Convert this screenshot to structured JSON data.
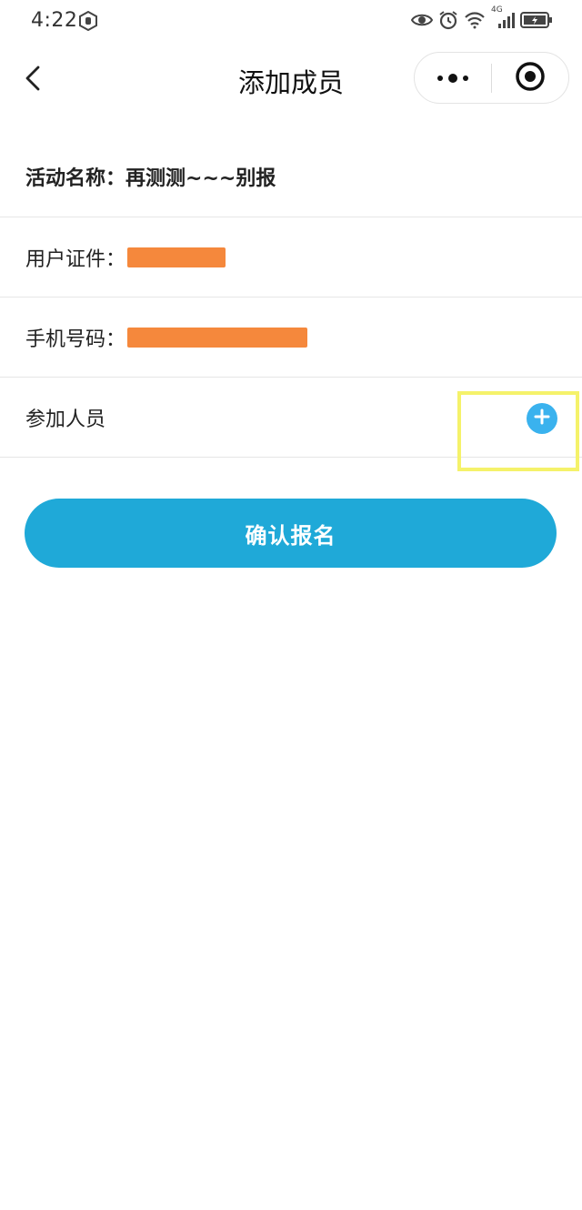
{
  "status_bar": {
    "time": "4:22",
    "network": "4G"
  },
  "nav": {
    "title": "添加成员"
  },
  "form": {
    "activity_label": "活动名称：",
    "activity_value": "再测测~~~别报",
    "id_label": "用户证件：",
    "phone_label": "手机号码：",
    "members_label": "参加人员"
  },
  "confirm_button": {
    "label": "确认报名"
  },
  "colors": {
    "accent": "#1fa9d8",
    "add_button": "#3ab2ee",
    "redaction": "#f5883c",
    "highlight": "#f5f26a"
  },
  "icons": {
    "back": "chevron-left-icon",
    "more": "more-dots-icon",
    "close": "target-close-icon",
    "add": "plus-icon"
  }
}
